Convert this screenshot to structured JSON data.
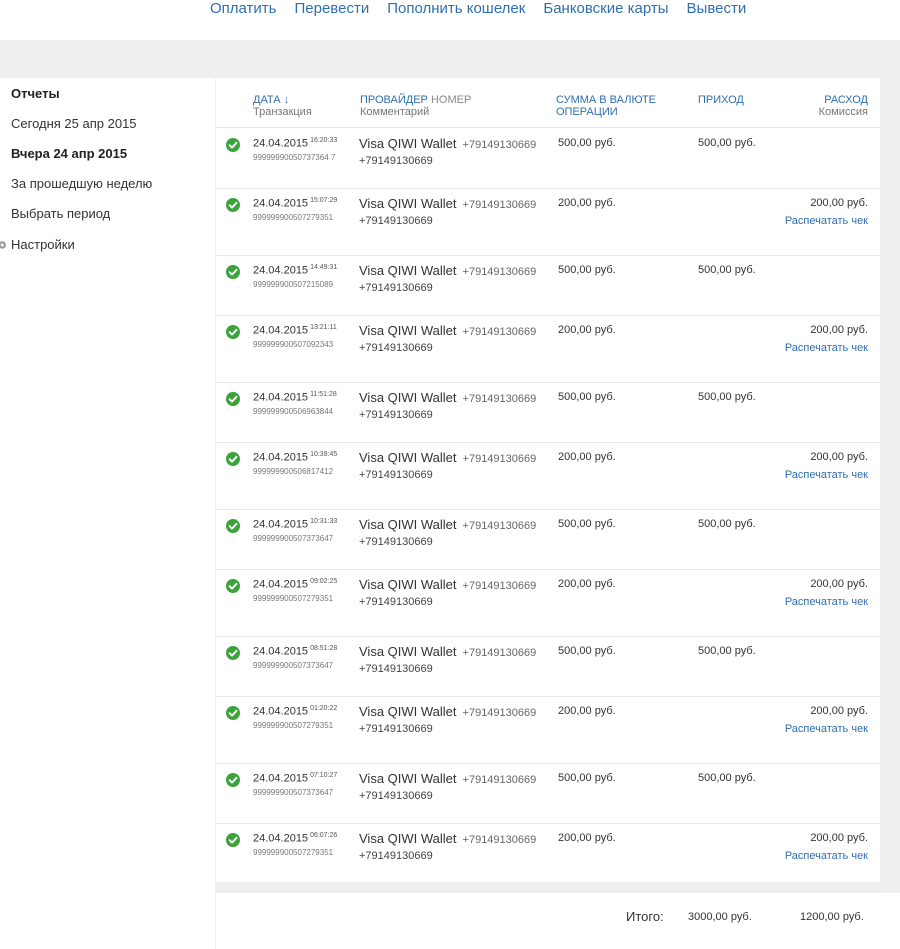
{
  "topnav": [
    "Оплатить",
    "Перевести",
    "Пополнить кошелек",
    "Банковские карты",
    "Вывести"
  ],
  "sidebar": {
    "title": "Отчеты",
    "items": [
      "Сегодня 25 апр 2015",
      "Вчера 24 апр 2015",
      "За прошедшую неделю",
      "Выбрать период"
    ],
    "settings": "Настройки"
  },
  "table": {
    "headers": {
      "date": "ДАТА ↓",
      "date_sub": "Транзакция",
      "provider": "ПРОВАЙДЕР",
      "number": "НОМЕР",
      "provider_sub": "Комментарий",
      "amount_line1": "СУММА В ВАЛЮТЕ",
      "amount_line2": "ОПЕРАЦИИ",
      "income": "ПРИХОД",
      "expense": "РАСХОД",
      "expense_sub": "Комиссия"
    },
    "rows": [
      {
        "date": "24.04.2015",
        "time": "16:20:33",
        "txn": "99999990050737364 7",
        "provider": "Visa QIWI Wallet",
        "number": "+79149130669",
        "comment": "+79149130669",
        "amount": "500,00 руб.",
        "income": "500,00 руб.",
        "expense": "",
        "print": ""
      },
      {
        "date": "24.04.2015",
        "time": "15:07:29",
        "txn": "999999900507279351",
        "provider": "Visa QIWI Wallet",
        "number": "+79149130669",
        "comment": "+79149130669",
        "amount": "200,00 руб.",
        "income": "",
        "expense": "200,00 руб.",
        "print": "Распечатать чек"
      },
      {
        "date": "24.04.2015",
        "time": "14:49:31",
        "txn": "999999900507215089",
        "provider": "Visa QIWI Wallet",
        "number": "+79149130669",
        "comment": "+79149130669",
        "amount": "500,00 руб.",
        "income": "500,00 руб.",
        "expense": "",
        "print": ""
      },
      {
        "date": "24.04.2015",
        "time": "13:21:11",
        "txn": "999999900507092343",
        "provider": "Visa QIWI Wallet",
        "number": "+79149130669",
        "comment": "+79149130669",
        "amount": "200,00 руб.",
        "income": "",
        "expense": "200,00 руб.",
        "print": "Распечатать чек"
      },
      {
        "date": "24.04.2015",
        "time": "11:51:28",
        "txn": "999999900506963844",
        "provider": "Visa QIWI Wallet",
        "number": "+79149130669",
        "comment": "+79149130669",
        "amount": "500,00 руб.",
        "income": "500,00 руб.",
        "expense": "",
        "print": ""
      },
      {
        "date": "24.04.2015",
        "time": "10:39:45",
        "txn": "999999900506817412",
        "provider": "Visa QIWI Wallet",
        "number": "+79149130669",
        "comment": "+79149130669",
        "amount": "200,00 руб.",
        "income": "",
        "expense": "200,00 руб.",
        "print": "Распечатать чек"
      },
      {
        "date": "24.04.2015",
        "time": "10:31:33",
        "txn": "999999900507373647",
        "provider": "Visa QIWI Wallet",
        "number": "+79149130669",
        "comment": "+79149130669",
        "amount": "500,00 руб.",
        "income": "500,00 руб.",
        "expense": "",
        "print": ""
      },
      {
        "date": "24.04.2015",
        "time": "09:02:25",
        "txn": "999999900507279351",
        "provider": "Visa QIWI Wallet",
        "number": "+79149130669",
        "comment": "+79149130669",
        "amount": "200,00 руб.",
        "income": "",
        "expense": "200,00 руб.",
        "print": "Распечатать чек"
      },
      {
        "date": "24.04.2015",
        "time": "08:51:28",
        "txn": "999999900507373647",
        "provider": "Visa QIWI Wallet",
        "number": "+79149130669",
        "comment": "+79149130669",
        "amount": "500,00 руб.",
        "income": "500,00 руб.",
        "expense": "",
        "print": ""
      },
      {
        "date": "24.04.2015",
        "time": "01:20:22",
        "txn": "999999900507279351",
        "provider": "Visa QIWI Wallet",
        "number": "+79149130669",
        "comment": "+79149130669",
        "amount": "200,00 руб.",
        "income": "",
        "expense": "200,00 руб.",
        "print": "Распечатать чек"
      },
      {
        "date": "24.04.2015",
        "time": "07:10:27",
        "txn": "999999900507373647",
        "provider": "Visa QIWI Wallet",
        "number": "+79149130669",
        "comment": "+79149130669",
        "amount": "500,00 руб.",
        "income": "500,00 руб.",
        "expense": "",
        "print": ""
      },
      {
        "date": "24.04.2015",
        "time": "06:07:26",
        "txn": "999999900507279351",
        "provider": "Visa QIWI Wallet",
        "number": "+79149130669",
        "comment": "+79149130669",
        "amount": "200,00 руб.",
        "income": "",
        "expense": "200,00 руб.",
        "print": "Распечатать чек"
      }
    ]
  },
  "totals": {
    "label": "Итого:",
    "income": "3000,00 руб.",
    "expense": "1200,00 руб."
  },
  "colors": {
    "link": "#2f6fae",
    "check": "#3aa33a",
    "background": "#efefef"
  }
}
